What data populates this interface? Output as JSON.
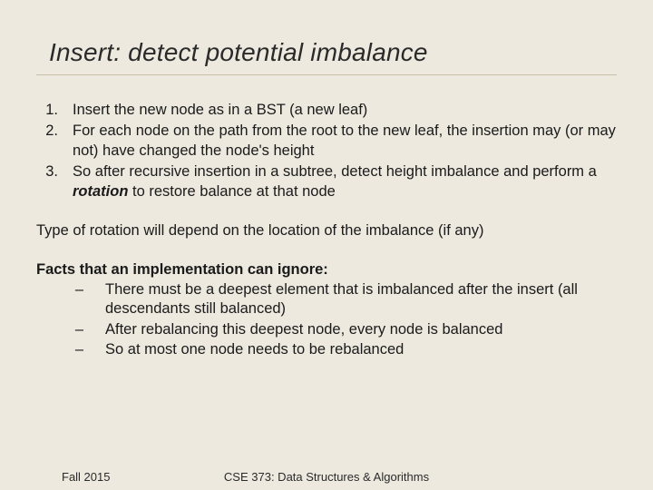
{
  "title": "Insert: detect potential imbalance",
  "steps": {
    "n1": "1.",
    "t1": "Insert the new node as in a BST (a new leaf)",
    "n2": "2.",
    "t2": "For each node on the path from the root to the new leaf, the insertion may (or may not) have changed the node's height",
    "n3": "3.",
    "t3a": "So after recursive insertion in a subtree, detect height imbalance and perform a ",
    "rot": "rotation",
    "t3b": " to restore balance at that node"
  },
  "typeline": "Type of rotation will depend on the location of the imbalance (if any)",
  "facts": {
    "head": "Facts that an implementation can ignore:",
    "dash": "–",
    "b1": "There must be a deepest element that is imbalanced after the insert (all descendants still balanced)",
    "b2": "After rebalancing this deepest node, every node is balanced",
    "b3": "So at most one node needs to be rebalanced"
  },
  "footer": {
    "left": "Fall 2015",
    "center": "CSE 373: Data Structures & Algorithms"
  }
}
